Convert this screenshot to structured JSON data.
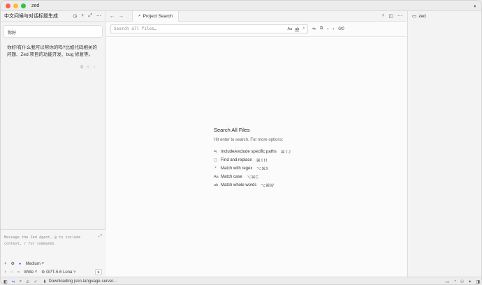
{
  "window": {
    "app_name": "zed"
  },
  "agent": {
    "title": "中文问候与对话标题生成",
    "user_message": "你好",
    "reply": "你好!有什么我可以帮你的吗?比如代码相关的问题、Zed 项目的功能开发、bug 修复等。",
    "composer_placeholder": "Message the Zed Agent, @ to include context, / for commands",
    "thinking_level": "Medium",
    "mode": "Write",
    "model": "GPT-5.6 Luna"
  },
  "editor": {
    "tab_label": "Project Search",
    "search_placeholder": "Search all files…",
    "opt_case": "Aa",
    "opt_word": "ab",
    "opt_regex": ".*",
    "match_count": "0/0",
    "empty_title": "Search All Files",
    "empty_hint": "Hit enter to search. For more options:",
    "options": [
      {
        "icon": "include-exclude-icon",
        "glyph": "⇋",
        "label": "Include/exclude specific paths",
        "kbd": "⌘⇧J"
      },
      {
        "icon": "replace-icon",
        "glyph": "▢",
        "label": "Find and replace",
        "kbd": "⌘⇧H"
      },
      {
        "icon": "regex-icon",
        "glyph": ".*",
        "label": "Match with regex",
        "kbd": "⌥⌘X"
      },
      {
        "icon": "case-icon",
        "glyph": "Aa",
        "label": "Match case",
        "kbd": "⌥⌘C"
      },
      {
        "icon": "whole-word-icon",
        "glyph": "ab",
        "label": "Match whole words",
        "kbd": "⌥⌘W"
      }
    ]
  },
  "project_panel": {
    "root": "zed"
  },
  "status": {
    "message": "Downloading json-language-server..."
  }
}
